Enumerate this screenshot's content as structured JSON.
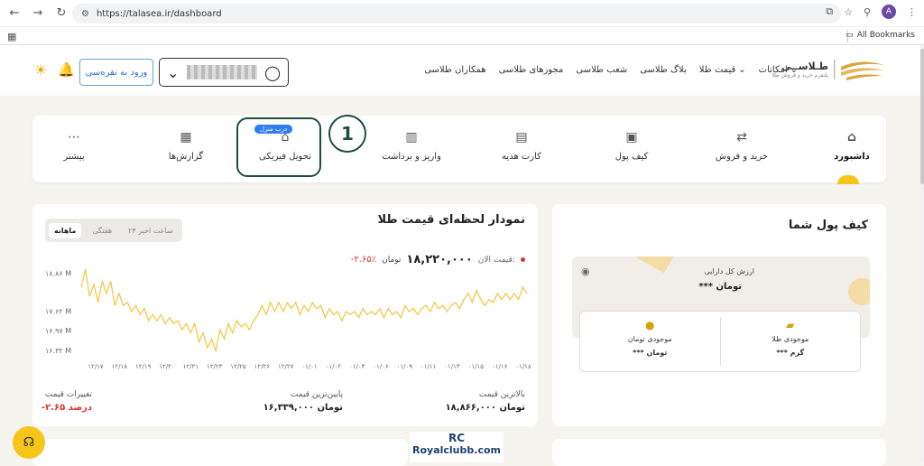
{
  "browser": {
    "url": "https://talasea.ir/dashboard",
    "bookmarks_label": "All Bookmarks",
    "profile_initial": "A"
  },
  "header": {
    "logo_name": "طـلاســی",
    "logo_sub": "پلتفرم خرید و فروش طلا",
    "menu": [
      {
        "label": "امکانات",
        "has_dropdown": true
      },
      {
        "label": "قیمت طلا",
        "has_dropdown": true
      },
      {
        "label": "بلاگ طلاسی",
        "has_dropdown": false
      },
      {
        "label": "شعب طلاسی",
        "has_dropdown": false
      },
      {
        "label": "مجوزهای طلاسی",
        "has_dropdown": false
      },
      {
        "label": "همکاران طلاسی",
        "has_dropdown": false
      }
    ],
    "login_label": "ورود به نقره‌سی"
  },
  "tabs": [
    {
      "label": "داشبورد",
      "icon": "home-icon",
      "active": true
    },
    {
      "label": "خرید و فروش",
      "icon": "exchange-icon",
      "active": false
    },
    {
      "label": "کیف پول",
      "icon": "wallet-icon",
      "active": false
    },
    {
      "label": "کارت هدیه",
      "icon": "gift-card-icon",
      "active": false
    },
    {
      "label": "واریز و برداشت",
      "icon": "deposit-icon",
      "active": false
    },
    {
      "label": "تحویل فیزیکی",
      "icon": "store-icon",
      "active": false,
      "badge": "درب منزل"
    },
    {
      "label": "گزارش‌ها",
      "icon": "report-icon",
      "active": false
    },
    {
      "label": "بیشتر",
      "icon": "more-icon",
      "active": false
    }
  ],
  "annotation_number": "1",
  "chart_panel": {
    "title": "نمودار لحظه‌ای قیمت طلا",
    "ranges": [
      "۲۴ ساعت اخیر",
      "هفتگی",
      "ماهانه"
    ],
    "active_range": "ماهانه",
    "price_label": "قیمت الان:",
    "price_value": "۱۸,۲۲۰,۰۰۰",
    "price_unit": "تومان",
    "price_change": "-۲.۶۵٪",
    "stats": [
      {
        "label": "بالاترین قیمت",
        "value": "۱۸,۸۶۶,۰۰۰ تومان"
      },
      {
        "label": "پایین‌ترین قیمت",
        "value": "۱۶,۳۳۹,۰۰۰ تومان"
      },
      {
        "label": "تغییرات قیمت",
        "value": "-۲.۶۵ درصد"
      }
    ]
  },
  "chart_data": {
    "type": "line",
    "y_tick_labels": [
      "۱۸.۸۶ M",
      "۱۷.۶۲ M",
      "۱۶.۹۷ M",
      "۱۶.۳۲ M"
    ],
    "y_ticks": [
      18.86,
      17.62,
      16.97,
      16.32
    ],
    "ylim": [
      16.2,
      19.0
    ],
    "x_tick_labels": [
      "۱۲/۱۷",
      "۱۲/۱۸",
      "۱۲/۱۹",
      "۱۲/۲۰",
      "۱۲/۲۱",
      "۱۲/۲۳",
      "۱۲/۲۵",
      "۱۲/۲۶",
      "۱۲/۲۷",
      "۰۱/۰۱",
      "۰۱/۰۲",
      "۰۱/۰۴",
      "۰۱/۰۶",
      "۰۱/۰۹",
      "۰۱/۱۱",
      "۰۱/۱۳",
      "۰۱/۱۵",
      "۰۱/۱۶",
      "۰۱/۱۸"
    ],
    "color": "#f2c94c",
    "values": [
      18.4,
      19.0,
      18.1,
      18.5,
      17.9,
      18.6,
      18.2,
      18.6,
      17.8,
      18.2,
      17.8,
      17.9,
      17.6,
      17.8,
      17.5,
      17.7,
      17.3,
      17.5,
      17.3,
      17.5,
      17.2,
      17.4,
      17.2,
      17.3,
      17.0,
      17.2,
      16.9,
      17.2,
      16.6,
      16.9,
      16.4,
      16.7,
      16.3,
      17.0,
      16.7,
      17.2,
      16.9,
      17.3,
      17.1,
      17.2,
      17.0,
      17.3,
      17.5,
      17.8,
      17.5,
      17.9,
      17.6,
      17.9,
      17.6,
      17.9,
      17.7,
      17.9,
      17.5,
      17.8,
      17.6,
      17.9,
      17.7,
      17.8,
      17.4,
      17.7,
      17.5,
      17.6,
      17.3,
      17.6,
      17.5,
      17.6,
      17.4,
      17.7,
      17.5,
      17.6,
      17.5,
      17.7,
      17.4,
      17.7,
      17.5,
      17.6,
      17.4,
      17.8,
      17.6,
      17.7,
      17.5,
      17.7,
      17.8,
      17.6,
      17.9,
      17.7,
      17.8,
      17.6,
      17.8,
      17.9,
      17.7,
      18.0,
      18.2,
      17.9,
      18.3,
      18.0,
      17.8,
      18.0,
      17.9,
      18.2,
      18.0,
      18.2,
      18.0,
      18.2,
      18.0,
      18.4,
      18.2
    ]
  },
  "wallet": {
    "title": "کیف پول شما",
    "total_label": "ارزش کل دارایی",
    "total_value": "*** تومان",
    "items": [
      {
        "label": "موجودی طلا",
        "value": "*** گرم",
        "icon": "gold-bar-icon"
      },
      {
        "label": "موجودی تومان",
        "value": "*** تومان",
        "icon": "coin-icon"
      }
    ]
  },
  "watermark": {
    "logo": "RC",
    "text": "Royalclubb.com"
  }
}
